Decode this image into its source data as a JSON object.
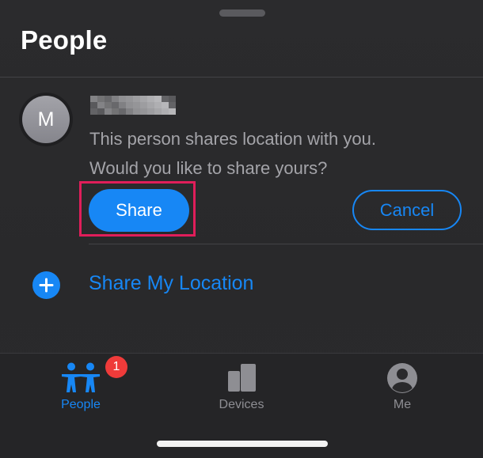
{
  "header": {
    "title": "People"
  },
  "person": {
    "avatar_initial": "M",
    "message_line1": "This person shares location with you.",
    "message_line2": "Would you like to share yours?"
  },
  "actions": {
    "share_label": "Share",
    "cancel_label": "Cancel"
  },
  "share_my_location": {
    "label": "Share My Location",
    "icon": "plus-circle-icon"
  },
  "tabbar": {
    "tabs": [
      {
        "label": "People",
        "icon": "people-icon",
        "badge": "1",
        "active": true
      },
      {
        "label": "Devices",
        "icon": "devices-icon",
        "active": false
      },
      {
        "label": "Me",
        "icon": "person-circle-icon",
        "active": false
      }
    ]
  },
  "colors": {
    "accent": "#1787f5",
    "background": "#2b2b2d",
    "secondary_text": "#a4a4a9",
    "highlight": "#e01e5a",
    "badge": "#ef3b3a",
    "inactive_tab": "#8e8e93"
  }
}
